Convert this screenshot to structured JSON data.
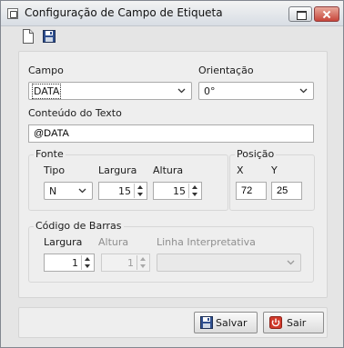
{
  "window": {
    "title": "Configuração de Campo de Etiqueta"
  },
  "toolbar": {
    "icons": [
      "new-document-icon",
      "save-floppy-icon"
    ]
  },
  "form": {
    "campo": {
      "label": "Campo",
      "value": "DATA"
    },
    "orientacao": {
      "label": "Orientação",
      "value": "0°"
    },
    "conteudo": {
      "label": "Conteúdo do Texto",
      "value": "@DATA"
    },
    "fonte": {
      "legend": "Fonte",
      "tipo_label": "Tipo",
      "tipo_value": "N",
      "largura_label": "Largura",
      "largura_value": "15",
      "altura_label": "Altura",
      "altura_value": "15"
    },
    "posicao": {
      "legend": "Posição",
      "x_label": "X",
      "x_value": "72",
      "y_label": "Y",
      "y_value": "25"
    },
    "barras": {
      "legend": "Código de Barras",
      "largura_label": "Largura",
      "largura_value": "1",
      "altura_label": "Altura",
      "altura_value": "1",
      "linha_label": "Linha Interpretativa",
      "linha_value": ""
    }
  },
  "buttons": {
    "save_label": "Salvar",
    "exit_label": "Sair"
  },
  "colors": {
    "exit_icon": "#d03a2b",
    "save_icon": "#2f4f8f"
  }
}
